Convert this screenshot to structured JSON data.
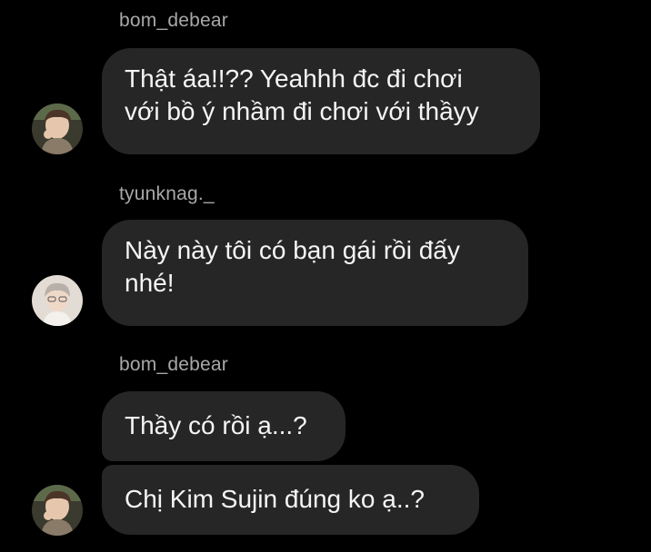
{
  "groups": [
    {
      "sender": "bom_debear",
      "messages": [
        {
          "lines": [
            "Thật áa!!?? Yeahhh đc đi chơi",
            "với bồ ý nhầm đi chơi với thầyy"
          ]
        }
      ]
    },
    {
      "sender": "tyunknag._",
      "messages": [
        {
          "lines": [
            "Này này tôi có bạn gái rồi đấy",
            "nhé!"
          ]
        }
      ]
    },
    {
      "sender": "bom_debear",
      "messages": [
        {
          "lines": [
            "Thầy có rồi ạ...?"
          ]
        },
        {
          "lines": [
            "Chị Kim Sujin đúng ko ạ..?"
          ]
        }
      ]
    }
  ],
  "avatars": {
    "bom_debear": {
      "icon": "user-avatar-photo",
      "tone": "#6a5a48"
    },
    "tyunknag._": {
      "icon": "user-avatar-photo",
      "tone": "#d8cfc8"
    }
  },
  "colors": {
    "background": "#000000",
    "bubble": "#262626",
    "text": "#f5f5f5",
    "username": "#a8a8a8"
  }
}
